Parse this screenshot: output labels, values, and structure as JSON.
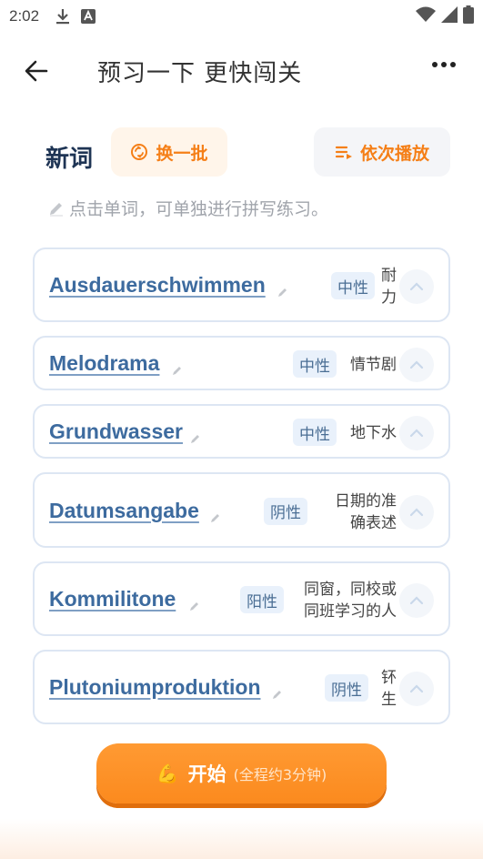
{
  "status_bar": {
    "time": "2:02"
  },
  "header": {
    "title": "预习一下 更快闯关"
  },
  "section": {
    "title": "新词",
    "refresh_label": "换一批",
    "play_label": "依次播放"
  },
  "hint": "点击单词，可单独进行拼写练习。",
  "words": [
    {
      "word": "Ausdauerschwimmen",
      "gender": "中性",
      "meaning": "耐\n力"
    },
    {
      "word": "Melodrama",
      "gender": "中性",
      "meaning": "情节剧"
    },
    {
      "word": "Grundwasser",
      "gender": "中性",
      "meaning": "地下水"
    },
    {
      "word": "Datumsangabe",
      "gender": "阴性",
      "meaning": "日期的准\n确表述"
    },
    {
      "word": "Kommilitone",
      "gender": "阳性",
      "meaning": "同窗，同校或\n同班学习的人"
    },
    {
      "word": "Plutoniumproduktion",
      "gender": "阴性",
      "meaning": "钚\n生"
    }
  ],
  "start_button": {
    "label": "开始",
    "sub": "(全程约3分钟)"
  },
  "colors": {
    "accent": "#f57f17",
    "word": "#3d6b9f",
    "title": "#1e3454"
  },
  "icons": {
    "back": "arrow-left-icon",
    "more": "more-dots-icon",
    "refresh": "refresh-icon",
    "play": "playlist-icon",
    "edit": "pencil-icon",
    "expand": "chevron-up-icon",
    "start": "flexed-biceps-icon"
  }
}
